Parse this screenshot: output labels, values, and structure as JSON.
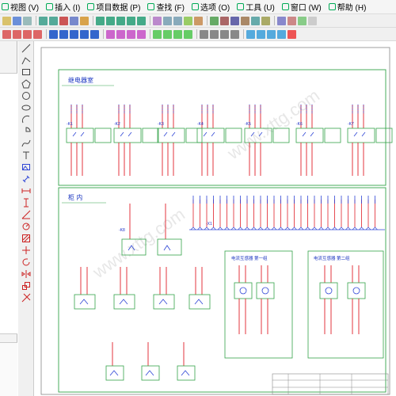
{
  "menu": [
    {
      "label": "视图 (V)"
    },
    {
      "label": "插入 (I)"
    },
    {
      "label": "项目数据 (P)"
    },
    {
      "label": "查找 (F)"
    },
    {
      "label": "选项 (O)"
    },
    {
      "label": "工具 (U)"
    },
    {
      "label": "窗口 (W)"
    },
    {
      "label": "帮助 (H)"
    }
  ],
  "drawing": {
    "section1_title": "继电器室",
    "section2_title": "柜 内",
    "box_left_title": "电流互感器  第一组",
    "box_right_title": "电流互感器  第二组",
    "relay_tags": [
      "-K1",
      "-K2",
      "-K3",
      "-K4",
      "-K5",
      "-K6",
      "-K7"
    ],
    "terminal_label": "-X1",
    "bottom_tag": "-K8",
    "watermark": "www.xttg.com"
  },
  "colors": {
    "wire_red": "#e0202a",
    "wire_blue": "#2e45d6",
    "frame_green": "#34a34a",
    "text_blue": "#1b2fc8",
    "title_blue": "#1a35c0"
  }
}
